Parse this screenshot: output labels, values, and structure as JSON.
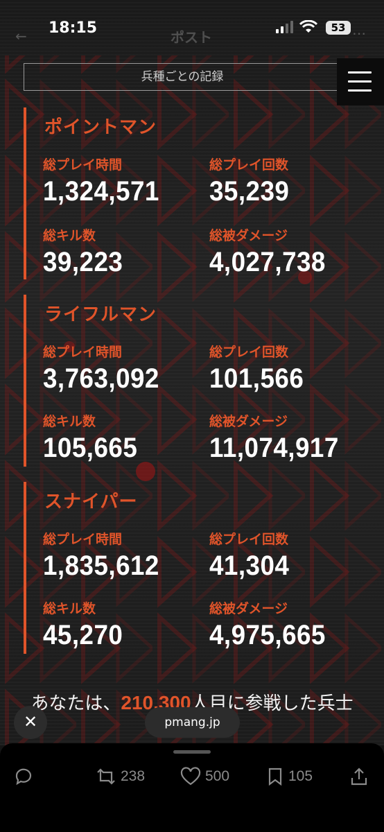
{
  "status_bar": {
    "time": "18:15",
    "battery": "53"
  },
  "header": {
    "title": "ポスト",
    "tab_label": "兵種ごとの記録"
  },
  "sections": [
    {
      "title": "ポイントマン",
      "stats": {
        "play_time_label": "総プレイ時間",
        "play_time": "1,324,571",
        "play_count_label": "総プレイ回数",
        "play_count": "35,239",
        "kills_label": "総キル数",
        "kills": "39,223",
        "damage_label": "総被ダメージ",
        "damage": "4,027,738"
      }
    },
    {
      "title": "ライフルマン",
      "stats": {
        "play_time_label": "総プレイ時間",
        "play_time": "3,763,092",
        "play_count_label": "総プレイ回数",
        "play_count": "101,566",
        "kills_label": "総キル数",
        "kills": "105,665",
        "damage_label": "総被ダメージ",
        "damage": "11,074,917"
      }
    },
    {
      "title": "スナイパー",
      "stats": {
        "play_time_label": "総プレイ時間",
        "play_time": "1,835,612",
        "play_count_label": "総プレイ回数",
        "play_count": "41,304",
        "kills_label": "総キル数",
        "kills": "45,270",
        "damage_label": "総被ダメージ",
        "damage": "4,975,665"
      }
    }
  ],
  "footer": {
    "text_before": "あなたは、",
    "number": "210,300",
    "text_after": "人目に参戦した兵士"
  },
  "media_overlay": {
    "close_label": "✕",
    "source": "pmang.jp"
  },
  "actions": {
    "retweets": "238",
    "likes": "500",
    "bookmarks": "105"
  },
  "colors": {
    "accent": "#e0542a",
    "background": "#141414"
  }
}
